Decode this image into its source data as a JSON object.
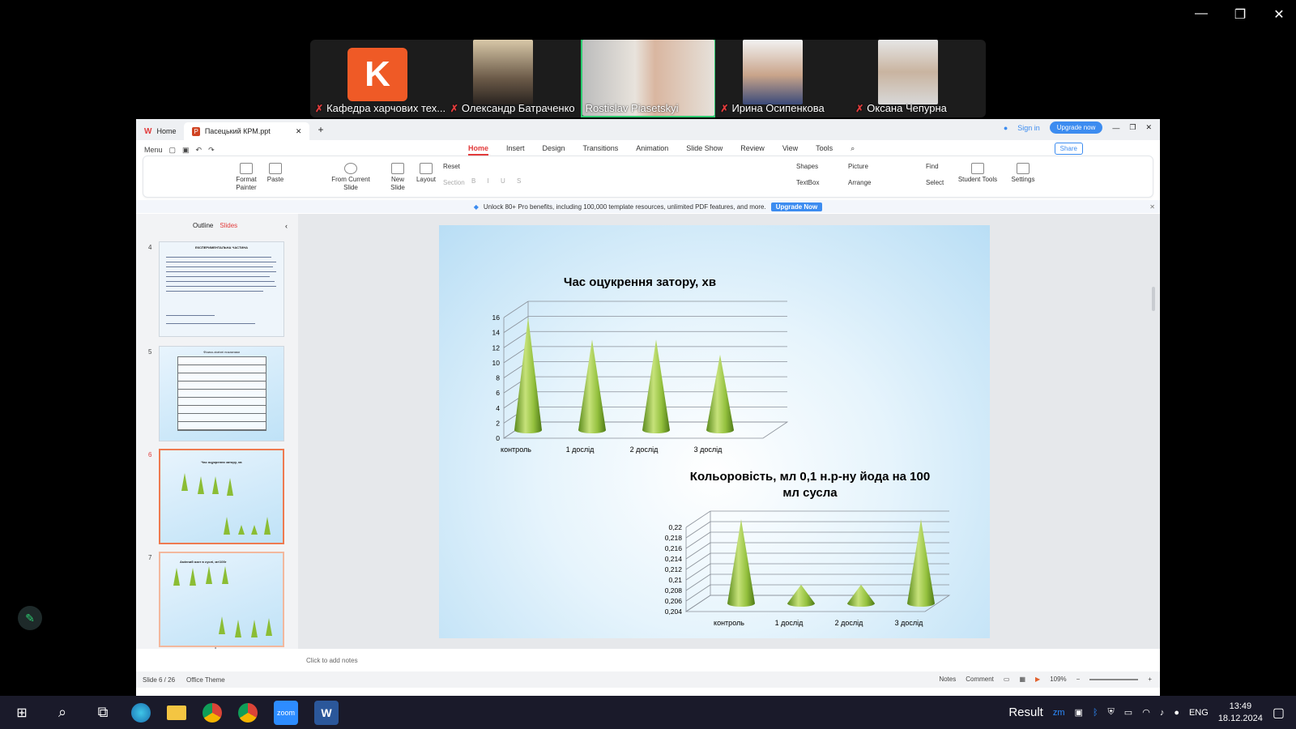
{
  "zoom_controls": {
    "minimize": "—",
    "restore": "❐",
    "close": "✕"
  },
  "participants": [
    {
      "name": "Кафедра харчових тех...",
      "avatar_letter": "K",
      "muted": true
    },
    {
      "name": "Олександр Батраченко",
      "muted": true
    },
    {
      "name": "Rostislav Piasetskyi",
      "muted": false,
      "active": true
    },
    {
      "name": "Ирина Осипенкова",
      "muted": true
    },
    {
      "name": "Оксана Чепурна",
      "muted": true
    }
  ],
  "wps": {
    "tabs": {
      "home": "Home",
      "file": "Пасецький КРМ.ppt"
    },
    "sign_in": "Sign in",
    "upgrade_now": "Upgrade now",
    "menu": "Menu",
    "menu_tabs": [
      "Home",
      "Insert",
      "Design",
      "Transitions",
      "Animation",
      "Slide Show",
      "Review",
      "View",
      "Tools"
    ],
    "share": "Share",
    "ribbon": {
      "format_painter": "Format Painter",
      "paste": "Paste",
      "from_current_slide": "From Current Slide",
      "new_slide": "New Slide",
      "layout": "Layout",
      "reset": "Reset",
      "section": "Section",
      "shapes": "Shapes",
      "picture": "Picture",
      "textbox": "TextBox",
      "arrange": "Arrange",
      "find": "Find",
      "select": "Select",
      "student_tools": "Student Tools",
      "settings": "Settings"
    },
    "banner": {
      "text": "Unlock 80+ Pro benefits, including 100,000 template resources, unlimited PDF features, and more.",
      "button": "Upgrade Now"
    },
    "panel_tabs": {
      "outline": "Outline",
      "slides": "Slides"
    },
    "thumbnails": [
      {
        "num": "4",
        "title": "ЕКСПЕРИМЕНТАЛЬНА ЧАСТИНА"
      },
      {
        "num": "5",
        "title": "Фізико-хімічні показники"
      },
      {
        "num": "6",
        "title": "Час оцукрення затору, хв"
      },
      {
        "num": "7",
        "title": "Амінний азот в суслі, мг/100г"
      }
    ],
    "notes_placeholder": "Click to add notes",
    "status": {
      "slide": "Slide 6 / 26",
      "theme": "Office Theme",
      "notes": "Notes",
      "comment": "Comment",
      "zoom": "109%"
    }
  },
  "chart_data": [
    {
      "type": "bar",
      "style": "3d-cone",
      "title": "Час оцукрення затору, хв",
      "categories": [
        "контроль",
        "1 дослід",
        "2 дослід",
        "3 дослід"
      ],
      "values": [
        15,
        12,
        12,
        10
      ],
      "ylim": [
        0,
        16
      ],
      "yticks": [
        "0",
        "2",
        "4",
        "6",
        "8",
        "10",
        "12",
        "14",
        "16"
      ],
      "grid": true,
      "color": "#8cbf3a"
    },
    {
      "type": "bar",
      "style": "3d-cone",
      "title": "Кольоровість, мл 0,1 н.р-ну йода на 100 мл сусла",
      "categories": [
        "контроль",
        "1 дослід",
        "2 дослід",
        "3 дослід"
      ],
      "values": [
        0.222,
        0.208,
        0.208,
        0.222
      ],
      "ylim": [
        0.204,
        0.222
      ],
      "yticks": [
        "0,204",
        "0,206",
        "0,208",
        "0,21",
        "0,212",
        "0,214",
        "0,216",
        "0,218",
        "0,22"
      ],
      "grid": true,
      "color": "#8cbf3a"
    }
  ],
  "taskbar": {
    "result": "Result",
    "lang": "ENG",
    "time": "13:49",
    "date": "18.12.2024"
  }
}
